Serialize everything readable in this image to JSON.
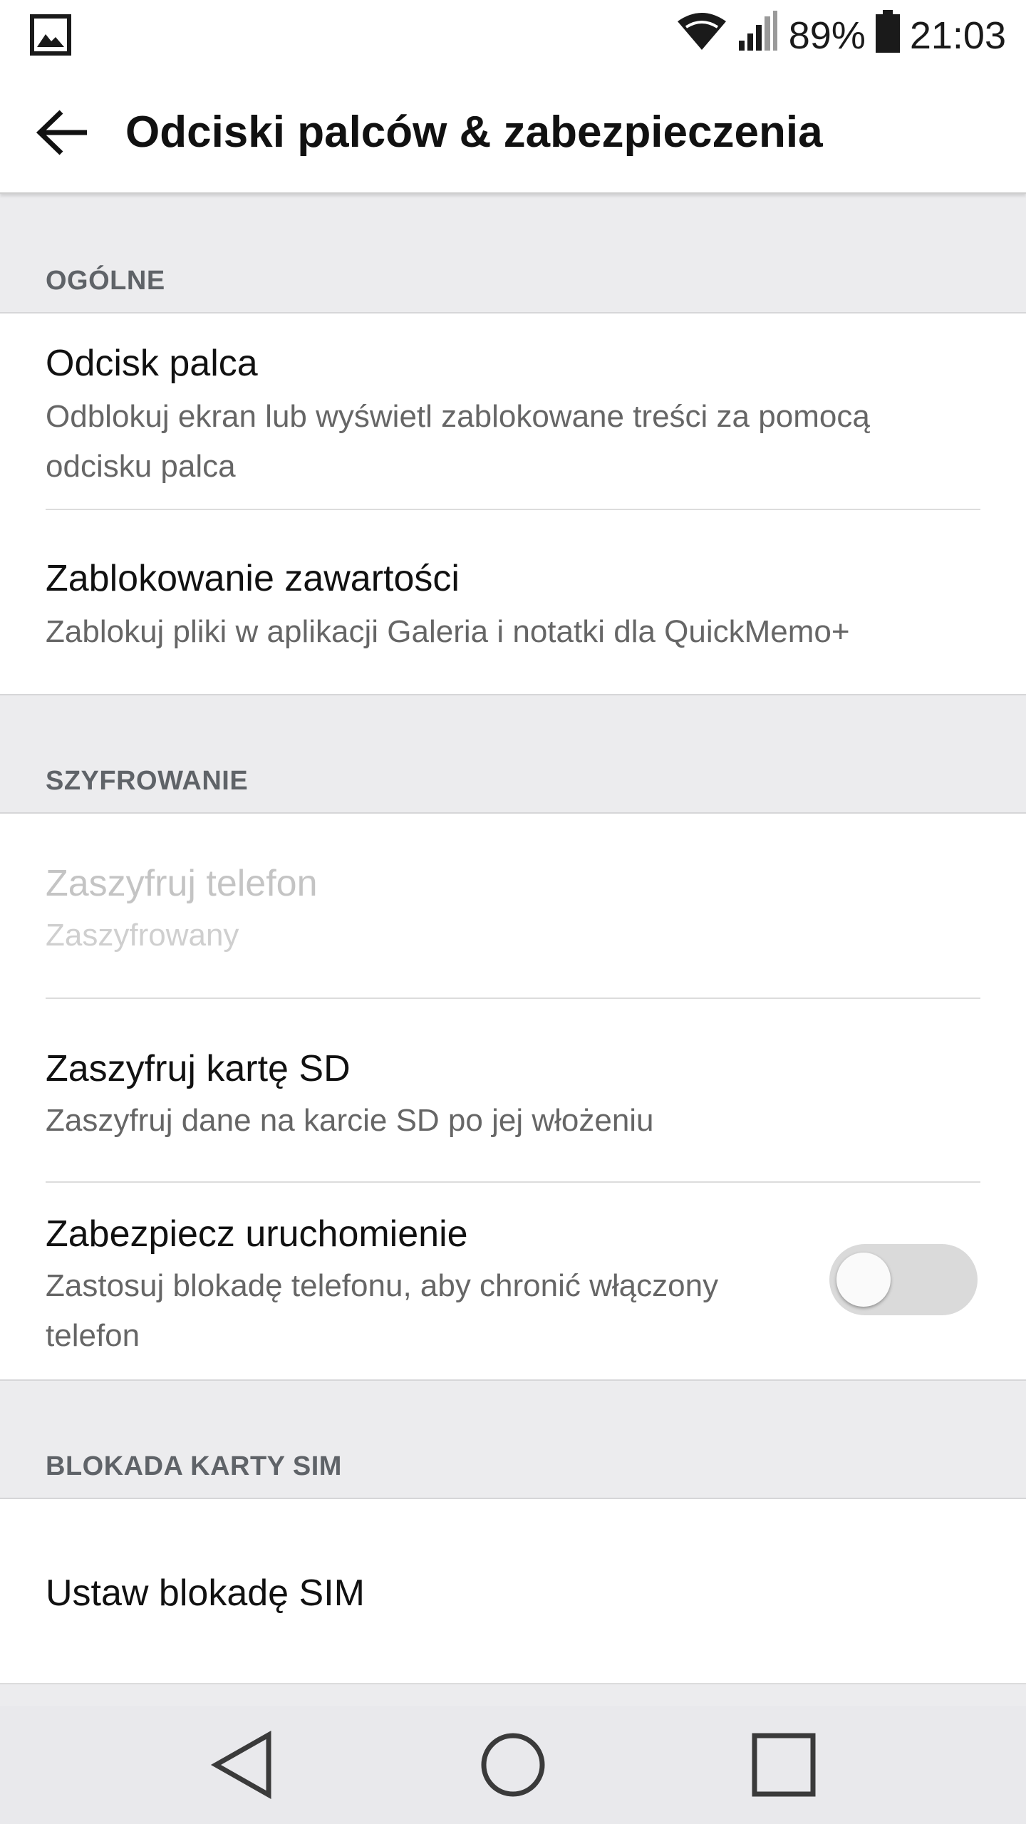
{
  "status_bar": {
    "battery_percent": "89%",
    "time": "21:03",
    "icons": [
      "image-notification-icon",
      "wifi-icon",
      "cellular-signal-icon",
      "battery-icon"
    ]
  },
  "toolbar": {
    "title": "Odciski palców & zabezpieczenia",
    "back_icon": "arrow-back-icon"
  },
  "sections": {
    "general": {
      "header": "OGÓLNE",
      "fingerprint": {
        "title": "Odcisk palca",
        "summary_line1": "Odblokuj ekran lub wyświetl zablokowane treści za pomocą",
        "summary_line2": "odcisku palca"
      },
      "content_lock": {
        "title": "Zablokowanie zawartości",
        "summary": "Zablokuj pliki w aplikacji Galeria i notatki dla QuickMemo+"
      }
    },
    "encryption": {
      "header": "SZYFROWANIE",
      "encrypt_phone": {
        "title": "Zaszyfruj telefon",
        "summary": "Zaszyfrowany",
        "enabled": false
      },
      "encrypt_sd": {
        "title": "Zaszyfruj kartę SD",
        "summary": "Zaszyfruj dane na karcie SD po jej włożeniu"
      },
      "secure_startup": {
        "title": "Zabezpiecz uruchomienie",
        "summary_line1": "Zastosuj blokadę telefonu, aby chronić włączony",
        "summary_line2": "telefon",
        "toggle_on": false
      }
    },
    "sim_lock": {
      "header": "BLOKADA KARTY SIM",
      "set_sim_lock": {
        "title": "Ustaw blokadę SIM"
      }
    }
  },
  "nav_bar": {
    "buttons": [
      "back-triangle-icon",
      "home-circle-icon",
      "recents-square-icon"
    ]
  },
  "colors": {
    "section_background": "#ececee",
    "header_text": "#5f6368",
    "disabled_text": "#c4c4c4",
    "toggle_track_off": "#dadada"
  }
}
